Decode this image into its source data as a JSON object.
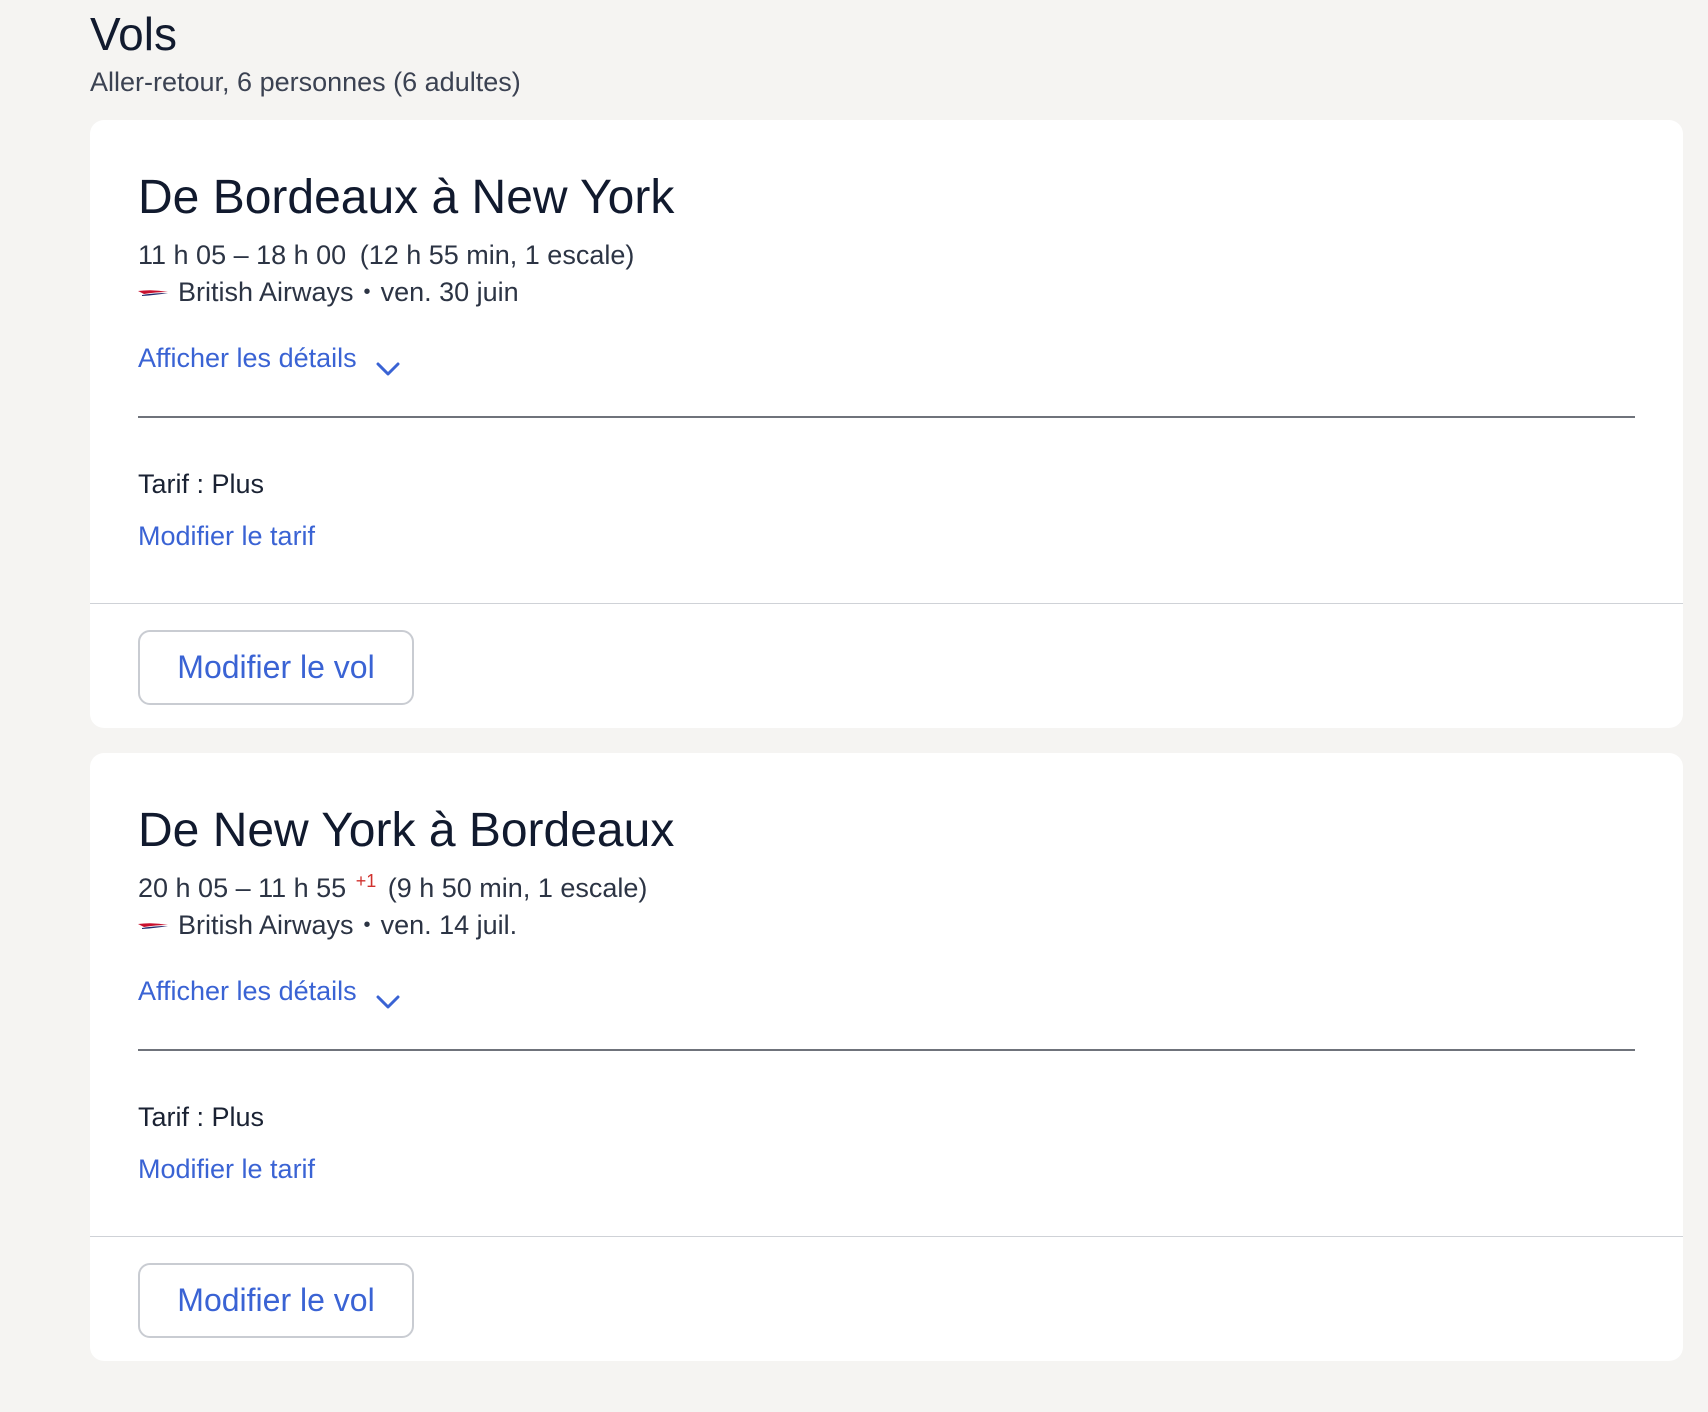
{
  "header": {
    "title": "Vols",
    "subtitle": "Aller-retour, 6 personnes (6 adultes)"
  },
  "flights": [
    {
      "route": "De Bordeaux à New York",
      "times": "11 h 05 – 18 h 00",
      "day_offset": "",
      "duration": "(12 h 55 min, 1 escale)",
      "airline": "British Airways",
      "date": "ven. 30 juin",
      "details_label": "Afficher les détails",
      "fare": "Tarif : Plus",
      "change_fare_label": "Modifier le tarif",
      "change_flight_label": "Modifier le vol"
    },
    {
      "route": "De New York à Bordeaux",
      "times": "20 h 05 – 11 h 55",
      "day_offset": "+1",
      "duration": "(9 h 50 min, 1 escale)",
      "airline": "British Airways",
      "date": "ven. 14 juil.",
      "details_label": "Afficher les détails",
      "fare": "Tarif : Plus",
      "change_fare_label": "Modifier le tarif",
      "change_flight_label": "Modifier le vol"
    }
  ],
  "separator": "•",
  "icons": {
    "airline_logo": "british-airways-speedmarque-icon",
    "expand": "chevron-down-icon"
  },
  "colors": {
    "link": "#3a63d4",
    "day_offset": "#d0312d",
    "background": "#f5f4f2"
  }
}
